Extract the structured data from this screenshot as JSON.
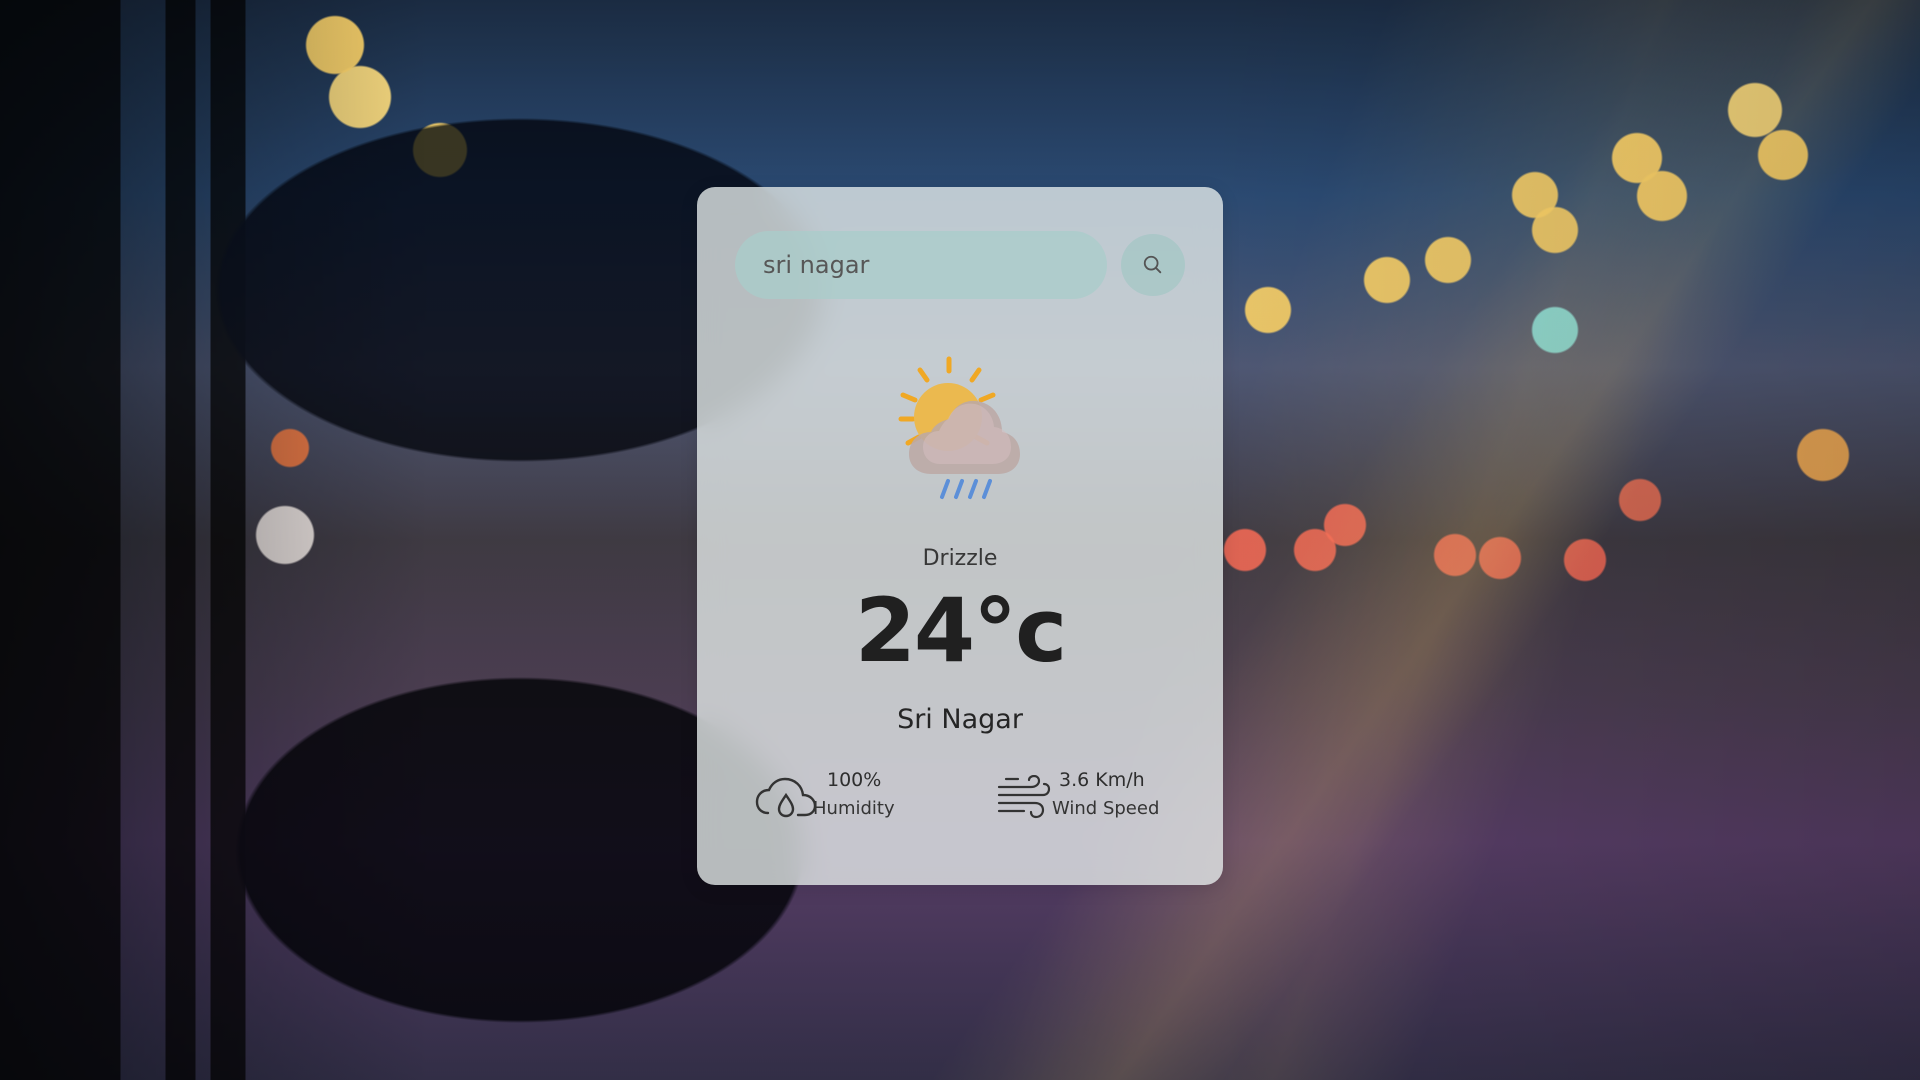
{
  "app": {
    "search": {
      "value": "sri nagar",
      "button_icon": "search-icon"
    },
    "weather": {
      "icon": "sun-cloud-drizzle-icon",
      "condition": "Drizzle",
      "temperature": "24°c",
      "city": "Sri Nagar"
    },
    "metrics": {
      "humidity": {
        "icon": "humidity-cloud-icon",
        "value": "100%",
        "label": "Humidity"
      },
      "wind": {
        "icon": "wind-icon",
        "value": "3.6 Km/h",
        "label": "Wind Speed"
      }
    },
    "colors": {
      "card": "#e7edec",
      "search": "#aacdcb",
      "sun": "#f0a824",
      "drizzle": "#5c8fd8",
      "text": "#252525"
    }
  }
}
